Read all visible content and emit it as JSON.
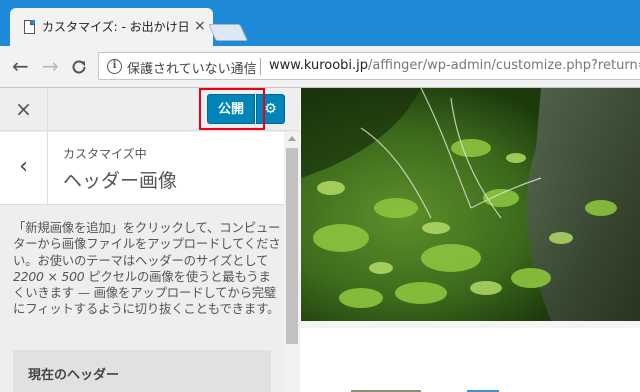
{
  "browser": {
    "tab_title": "カスタマイズ: - お出かけ日記",
    "tab_close": "×",
    "nav": {
      "back": "←",
      "forward": "→",
      "reload": "C"
    },
    "security_label": "保護されていない通信",
    "url_host": "www.kuroobi.jp",
    "url_path": "/affinger/wp-admin/customize.php?return=%"
  },
  "sidebar": {
    "close_symbol": "×",
    "publish_label": "公開",
    "gear_symbol": "⚙",
    "back_symbol": "‹",
    "breadcrumb": "カスタマイズ中",
    "section_title": "ヘッダー画像",
    "description_before": "「新規画像を追加」をクリックして、コンピューターから画像ファイルをアップロードしてください。お使いのテーマはヘッダーのサイズとして ",
    "description_size": "2200 × 500",
    "description_after": " ピクセルの画像を使うと最もうまくいきます — 画像をアップロードしてから完璧にフィットするように切り抜くこともできます。",
    "current_header_label": "現在のヘッダー"
  },
  "colors": {
    "chrome_blue": "#1e8ad8",
    "publish_blue": "#0085ba",
    "highlight_red": "#e8001e"
  }
}
